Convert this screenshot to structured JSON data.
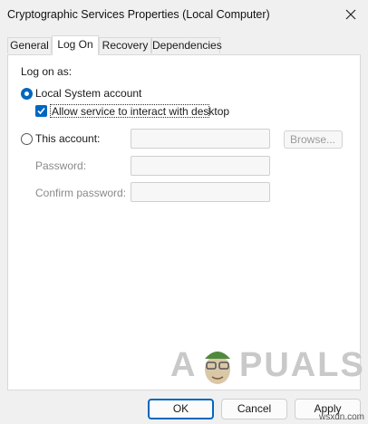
{
  "window": {
    "title": "Cryptographic Services Properties (Local Computer)",
    "close_icon": "close-icon"
  },
  "tabs": [
    {
      "label": "General",
      "active": false
    },
    {
      "label": "Log On",
      "active": true
    },
    {
      "label": "Recovery",
      "active": false
    },
    {
      "label": "Dependencies",
      "active": false
    }
  ],
  "logon": {
    "group_label": "Log on as:",
    "local_system": {
      "label": "Local System account",
      "selected": true
    },
    "interact_desktop": {
      "label": "Allow service to interact with desktop",
      "checked": true
    },
    "this_account": {
      "label": "This account:",
      "selected": false,
      "value": ""
    },
    "browse_label": "Browse...",
    "password_label": "Password:",
    "password_value": "",
    "confirm_label": "Confirm password:",
    "confirm_value": ""
  },
  "watermark": {
    "text_left": "A",
    "text_right": "PUALS"
  },
  "buttons": {
    "ok": "OK",
    "cancel": "Cancel",
    "apply": "Apply"
  },
  "credit": "wsxdn.com",
  "colors": {
    "accent": "#0067c0",
    "panel_bg": "#ffffff",
    "window_bg": "#f0f0f0"
  }
}
